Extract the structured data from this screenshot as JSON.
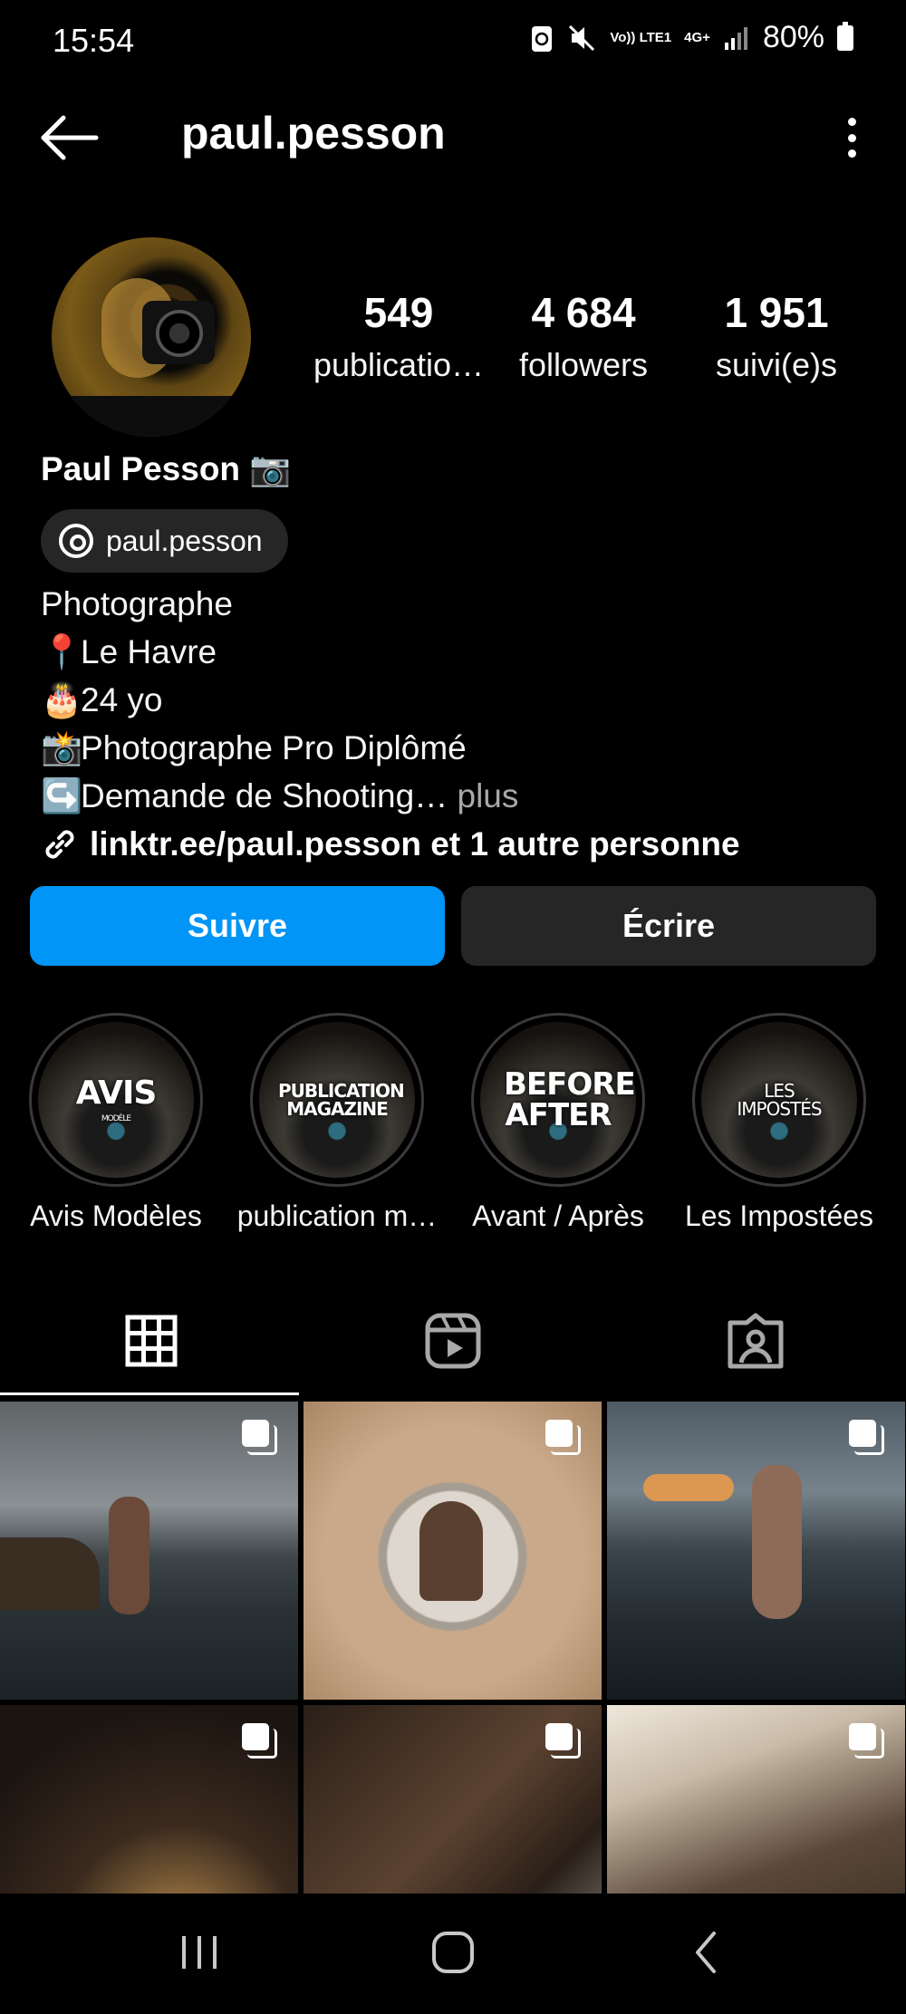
{
  "status_bar": {
    "time": "15:54",
    "network_1": "Vo)) LTE1",
    "network_2": "4G+",
    "battery": "80%"
  },
  "header": {
    "title": "paul.pesson",
    "back_icon": "arrow-left-icon",
    "menu_icon": "more-vertical-icon"
  },
  "profile": {
    "stats": [
      {
        "value": "549",
        "label": "publicatio…"
      },
      {
        "value": "4 684",
        "label": "followers"
      },
      {
        "value": "1 951",
        "label": "suivi(e)s"
      }
    ],
    "display_name": "Paul Pesson",
    "name_emoji": "📷",
    "threads_handle": "paul.pesson",
    "bio_lines": [
      {
        "emoji": "",
        "text": "Photographe"
      },
      {
        "emoji": "📍",
        "text": "Le Havre"
      },
      {
        "emoji": "🎂",
        "text": "24 yo"
      },
      {
        "emoji": "📸",
        "text": "Photographe Pro Diplômé"
      },
      {
        "emoji": "↪️",
        "text": "Demande de Shooting…"
      }
    ],
    "more_label": "plus",
    "link_text": "linktr.ee/paul.pesson et 1 autre personne"
  },
  "actions": {
    "follow_label": "Suivre",
    "message_label": "Écrire"
  },
  "highlights": [
    {
      "cover_text": "AVIS",
      "cover_sub": "MODÈLE",
      "label": "Avis Modèles"
    },
    {
      "cover_text": "PUBLICATION MAGAZINE",
      "cover_sub": "",
      "label": "publication m…"
    },
    {
      "cover_text": "BEFORE AFTER",
      "cover_sub": "",
      "label": "Avant / Après"
    },
    {
      "cover_text": "LES IMPOSTÉS",
      "cover_sub": "",
      "label": "Les Impostées"
    }
  ],
  "tabs": [
    {
      "name": "grid-icon",
      "active": true
    },
    {
      "name": "reels-icon",
      "active": false
    },
    {
      "name": "tagged-icon",
      "active": false
    }
  ],
  "colors": {
    "background": "#000000",
    "accent": "#0095f6",
    "button_secondary": "#262626",
    "muted_text": "#a8a8a8"
  }
}
